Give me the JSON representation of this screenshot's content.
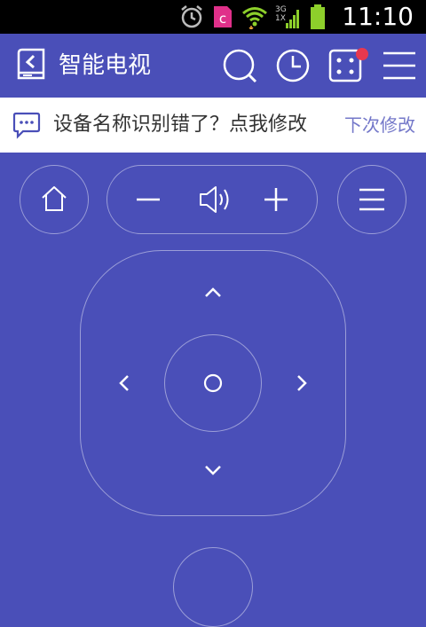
{
  "status_bar": {
    "time": "11:10",
    "icons": [
      "alarm-icon",
      "app-notification-icon",
      "wifi-icon",
      "3g-signal-icon",
      "battery-icon"
    ],
    "network_label_top": "3G",
    "network_label_bottom": "1X",
    "app_icon_letter": "c"
  },
  "header": {
    "title": "智能电视",
    "icons": [
      "back-device-icon",
      "search-icon",
      "history-icon",
      "apps-icon",
      "menu-icon"
    ],
    "has_apps_badge": true
  },
  "notice": {
    "text": "设备名称识别错了？点我修改",
    "link": "下次修改"
  },
  "remote": {
    "buttons": [
      "home-icon",
      "volume-down-icon",
      "speaker-icon",
      "volume-up-icon",
      "menu-icon",
      "up-arrow-icon",
      "left-arrow-icon",
      "ok-icon",
      "right-arrow-icon",
      "down-arrow-icon"
    ]
  },
  "colors": {
    "primary": "#4a4fb8",
    "badge": "#e8384f",
    "status_bar": "#000000",
    "notice_bg": "#ffffff",
    "notice_link": "#7478c9",
    "wifi_green": "#8dcf2b"
  }
}
